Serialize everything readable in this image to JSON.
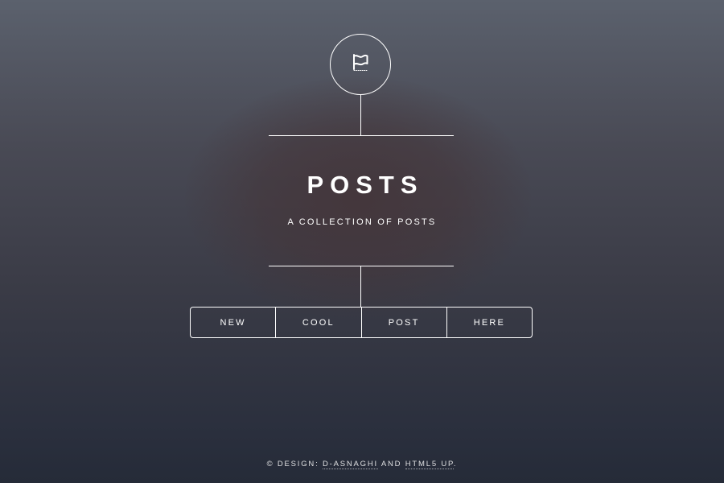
{
  "header": {
    "logo_icon": "flag-icon",
    "title": "POSTS",
    "subtitle": "A COLLECTION OF POSTS"
  },
  "nav": {
    "items": [
      {
        "label": "NEW"
      },
      {
        "label": "COOL"
      },
      {
        "label": "POST"
      },
      {
        "label": "HERE"
      }
    ]
  },
  "footer": {
    "prefix": "© DESIGN: ",
    "link1": "D-ASNAGHI",
    "and": " AND ",
    "link2": "HTML5 UP",
    "suffix": "."
  }
}
